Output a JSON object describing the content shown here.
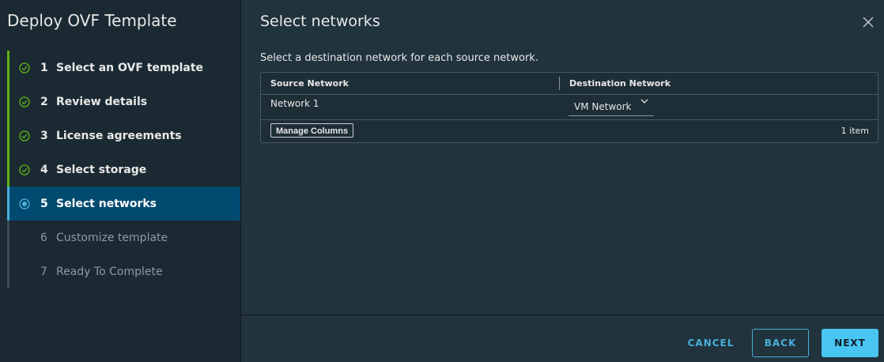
{
  "wizard": {
    "title": "Deploy OVF Template",
    "steps": [
      {
        "num": "1",
        "label": "Select an OVF template",
        "state": "done"
      },
      {
        "num": "2",
        "label": "Review details",
        "state": "done"
      },
      {
        "num": "3",
        "label": "License agreements",
        "state": "done"
      },
      {
        "num": "4",
        "label": "Select storage",
        "state": "done"
      },
      {
        "num": "5",
        "label": "Select networks",
        "state": "active"
      },
      {
        "num": "6",
        "label": "Customize template",
        "state": "todo"
      },
      {
        "num": "7",
        "label": "Ready To Complete",
        "state": "todo"
      }
    ]
  },
  "main": {
    "title": "Select networks",
    "subtitle": "Select a destination network for each source network.",
    "grid": {
      "columns": [
        "Source Network",
        "Destination Network"
      ],
      "rows": [
        {
          "source": "Network 1",
          "destination": "VM Network"
        }
      ],
      "manage_columns_label": "Manage Columns",
      "item_count": "1 item"
    }
  },
  "footer": {
    "cancel_label": "CANCEL",
    "back_label": "BACK",
    "next_label": "NEXT"
  },
  "icons": {
    "close": "close-icon",
    "done": "check-circle-icon",
    "active": "dot-circle-icon",
    "dropdown": "chevron-down-icon"
  },
  "colors": {
    "accent": "#49afd9",
    "done_bar": "#60b515",
    "primary_button": "#49c5f2"
  }
}
